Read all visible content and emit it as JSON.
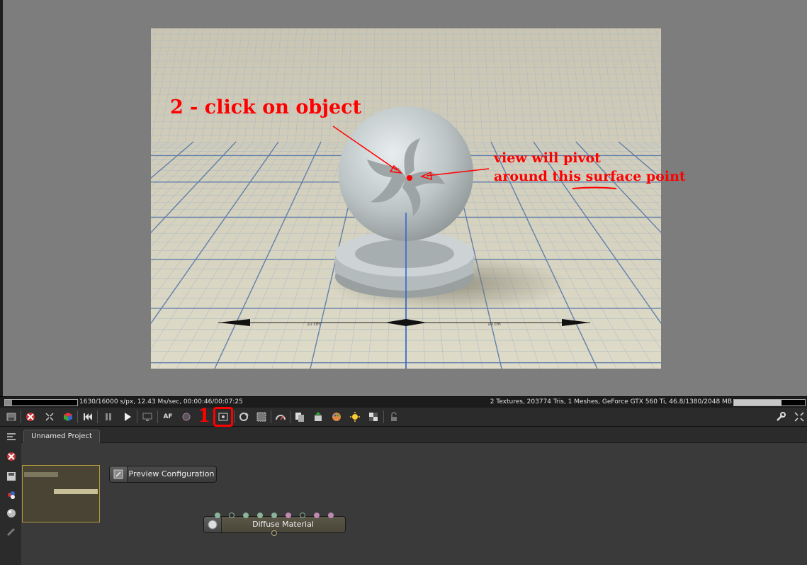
{
  "annotations": {
    "click_text": "2 - click on object",
    "pivot_line1": "view will pivot",
    "pivot_line2": "around this surface point",
    "step1_number": "1"
  },
  "render": {
    "scale_label_left": "10 cm",
    "scale_label_right": "10 cm"
  },
  "statusbar": {
    "left_text": "1630/16000 s/px, 12.43 Ms/sec, 00:00:46/00:07:25",
    "right_text": "2 Textures, 203774 Tris, 1 Meshes, GeForce GTX 560 Ti, 46.8/1380/2048 MB",
    "render_progress": 0.1019,
    "gpu_memory_fraction": 0.674
  },
  "toolbar": {
    "buttons": [
      "save-render-icon",
      "clear-icon",
      "fit-icon",
      "cube-icon",
      "rewind-icon",
      "pause-icon",
      "play-icon",
      "monitor-icon",
      "af-icon",
      "color-icon",
      "pick-pivot-icon",
      "rotate-view-icon",
      "region-icon",
      "gauge-icon",
      "copy-icon",
      "export-icon",
      "palette-icon",
      "sun-icon",
      "checker-icon",
      "lock-icon",
      "wrench-icon",
      "expand-icon"
    ],
    "af_label": "AF"
  },
  "project": {
    "tab_label": "Unnamed Project"
  },
  "nodes": {
    "preview": {
      "label": "Preview Configuration"
    },
    "diffuse": {
      "label": "Diffuse Material"
    }
  },
  "colors": {
    "annotation": "#ff0000",
    "pin_green": "#8ab39a",
    "pin_pink": "#c08ab0"
  }
}
